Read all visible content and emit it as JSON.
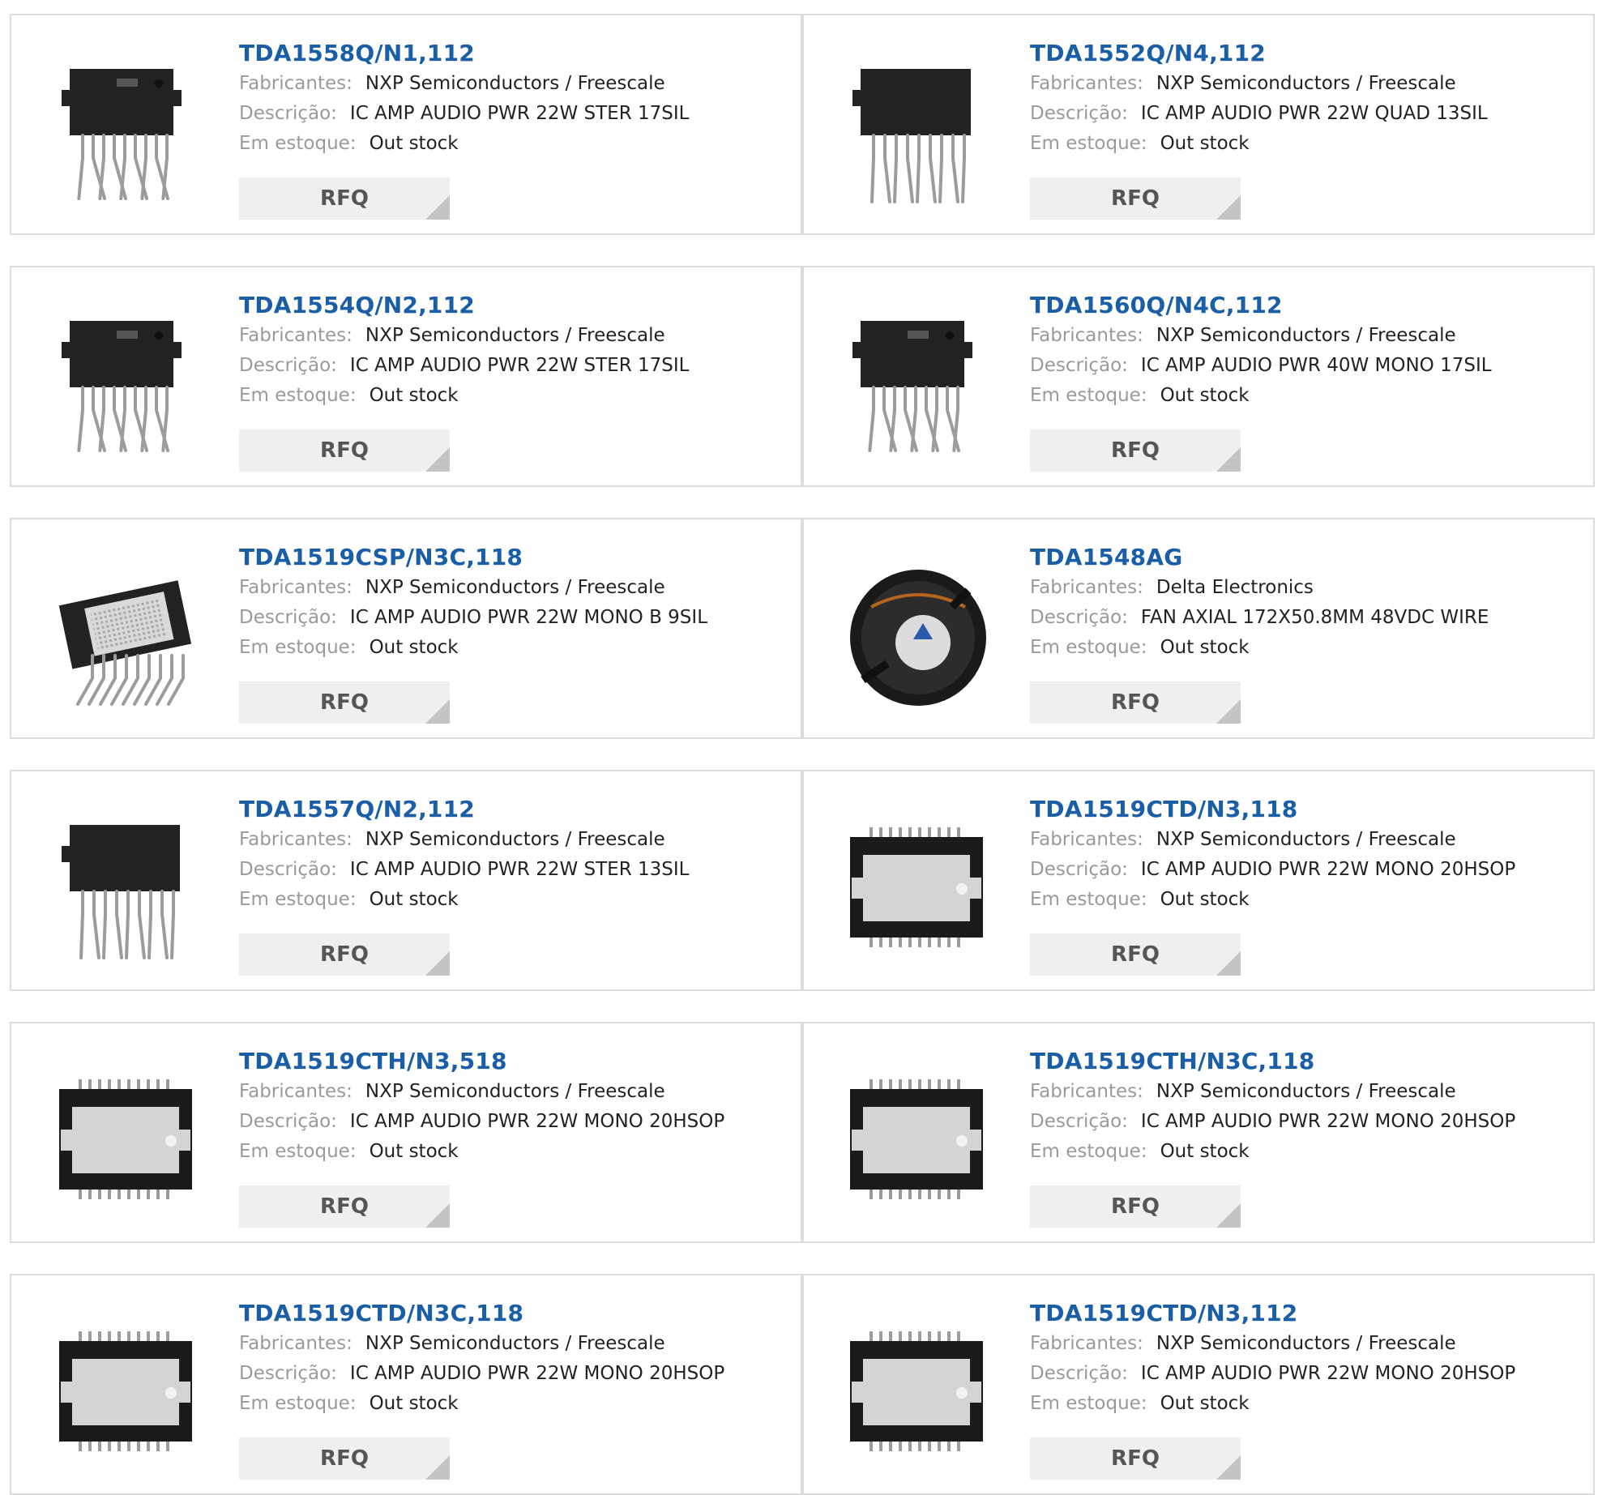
{
  "labels": {
    "manufacturer": "Fabricantes:",
    "description": "Descrição:",
    "stock": "Em estoque:",
    "rfq": "RFQ"
  },
  "colors": {
    "part_link": "#1a5ea8",
    "label_gray": "#9a9a9a",
    "border": "#dcdcdc",
    "rfq_bg": "#efefef"
  },
  "products": [
    {
      "part": "TDA1558Q/N1,112",
      "manufacturer": "NXP Semiconductors / Freescale",
      "description": "IC AMP AUDIO PWR 22W STER 17SIL",
      "stock": "Out stock",
      "image": "sil-bent-icon"
    },
    {
      "part": "TDA1552Q/N4,112",
      "manufacturer": "NXP Semiconductors / Freescale",
      "description": "IC AMP AUDIO PWR 22W QUAD 13SIL",
      "stock": "Out stock",
      "image": "sil-straight-icon"
    },
    {
      "part": "TDA1554Q/N2,112",
      "manufacturer": "NXP Semiconductors / Freescale",
      "description": "IC AMP AUDIO PWR 22W STER 17SIL",
      "stock": "Out stock",
      "image": "sil-bent-icon"
    },
    {
      "part": "TDA1560Q/N4C,112",
      "manufacturer": "NXP Semiconductors / Freescale",
      "description": "IC AMP AUDIO PWR 40W MONO 17SIL",
      "stock": "Out stock",
      "image": "sil-bent-icon"
    },
    {
      "part": "TDA1519CSP/N3C,118",
      "manufacturer": "NXP Semiconductors / Freescale",
      "description": "IC AMP AUDIO PWR 22W MONO B 9SIL",
      "stock": "Out stock",
      "image": "sip-heatsink-icon"
    },
    {
      "part": "TDA1548AG",
      "manufacturer": "Delta Electronics",
      "description": "FAN AXIAL 172X50.8MM 48VDC WIRE",
      "stock": "Out stock",
      "image": "axial-fan-icon"
    },
    {
      "part": "TDA1557Q/N2,112",
      "manufacturer": "NXP Semiconductors / Freescale",
      "description": "IC AMP AUDIO PWR 22W STER 13SIL",
      "stock": "Out stock",
      "image": "sil-straight-icon"
    },
    {
      "part": "TDA1519CTD/N3,118",
      "manufacturer": "NXP Semiconductors / Freescale",
      "description": "IC AMP AUDIO PWR 22W MONO 20HSOP",
      "stock": "Out stock",
      "image": "hsop-icon"
    },
    {
      "part": "TDA1519CTH/N3,518",
      "manufacturer": "NXP Semiconductors / Freescale",
      "description": "IC AMP AUDIO PWR 22W MONO 20HSOP",
      "stock": "Out stock",
      "image": "hsop-icon"
    },
    {
      "part": "TDA1519CTH/N3C,118",
      "manufacturer": "NXP Semiconductors / Freescale",
      "description": "IC AMP AUDIO PWR 22W MONO 20HSOP",
      "stock": "Out stock",
      "image": "hsop-icon"
    },
    {
      "part": "TDA1519CTD/N3C,118",
      "manufacturer": "NXP Semiconductors / Freescale",
      "description": "IC AMP AUDIO PWR 22W MONO 20HSOP",
      "stock": "Out stock",
      "image": "hsop-icon"
    },
    {
      "part": "TDA1519CTD/N3,112",
      "manufacturer": "NXP Semiconductors / Freescale",
      "description": "IC AMP AUDIO PWR 22W MONO 20HSOP",
      "stock": "Out stock",
      "image": "hsop-icon"
    }
  ]
}
